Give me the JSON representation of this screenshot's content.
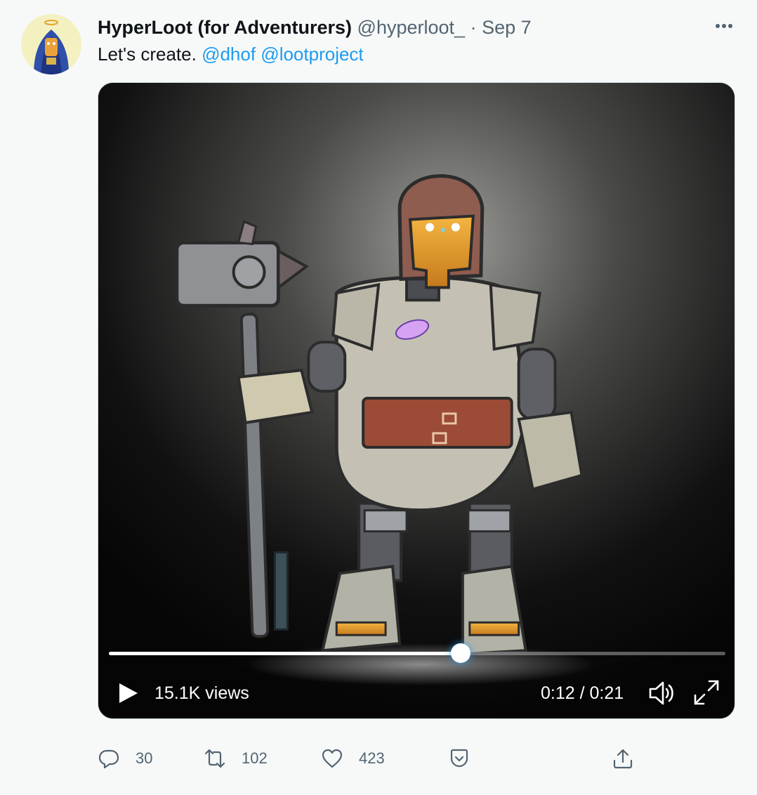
{
  "tweet": {
    "display_name": "HyperLoot (for Adventurers)",
    "handle": "@hyperloot_",
    "separator": "·",
    "date": "Sep 7",
    "text_prefix": "Let's create.",
    "mentions": [
      "@dhof",
      "@lootproject"
    ]
  },
  "video": {
    "views": "15.1K views",
    "time": "0:12 / 0:21",
    "progress_fraction": 0.571,
    "state": "paused"
  },
  "actions": {
    "replies": "30",
    "retweets": "102",
    "likes": "423"
  },
  "icons": {
    "more": "more-horizontal-icon",
    "play": "play-icon",
    "volume": "volume-icon",
    "fullscreen": "fullscreen-icon",
    "reply": "reply-icon",
    "retweet": "retweet-icon",
    "like": "heart-icon",
    "save": "save-icon",
    "share": "share-icon"
  },
  "colors": {
    "link": "#1d9bf0",
    "secondary_text": "#536471",
    "background": "#f7f9f9"
  }
}
